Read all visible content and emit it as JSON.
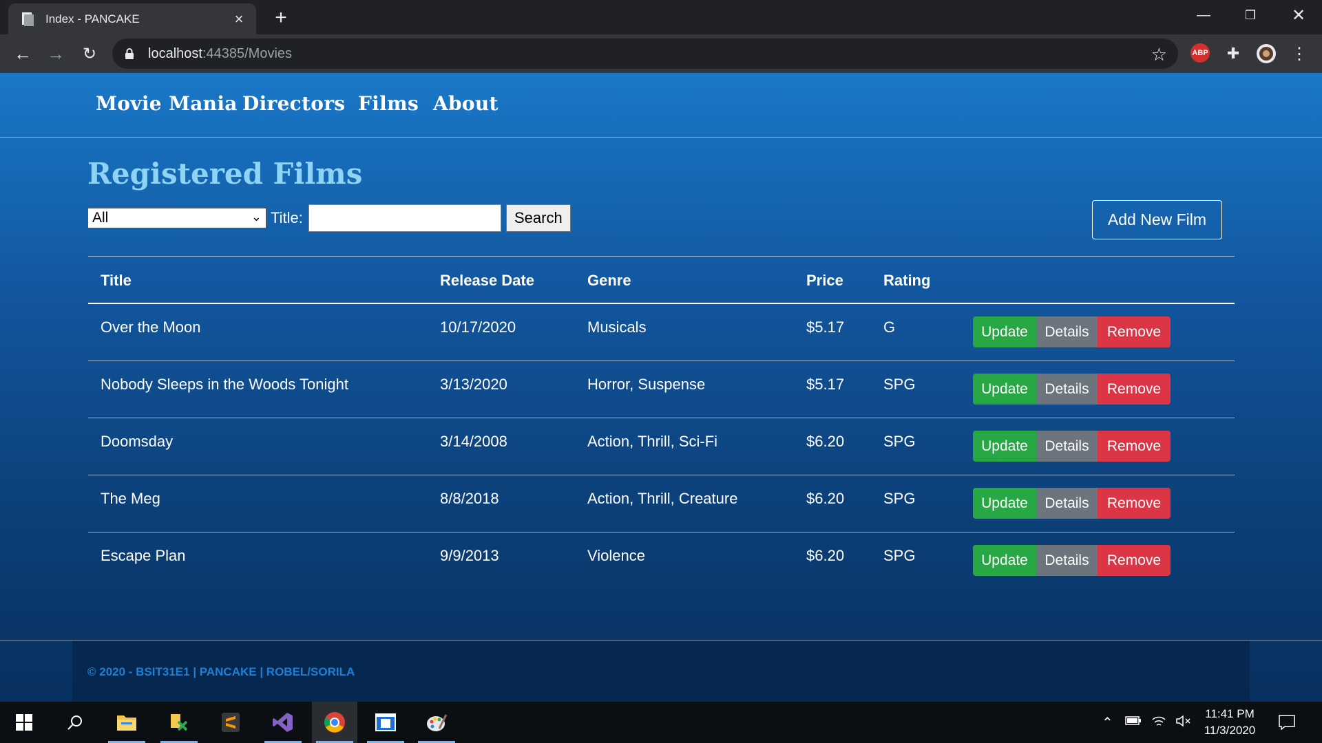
{
  "browser": {
    "tab_title": "Index - PANCAKE",
    "url_host": "localhost",
    "url_rest": ":44385/Movies",
    "abp_label": "ABP"
  },
  "nav": {
    "brand": "Movie Mania",
    "links": [
      "Directors",
      "Films",
      "About"
    ]
  },
  "page": {
    "heading": "Registered Films",
    "filter_selected": "All",
    "title_label": "Title:",
    "title_value": "",
    "search_label": "Search",
    "add_button": "Add New Film"
  },
  "table": {
    "columns": [
      "Title",
      "Release Date",
      "Genre",
      "Price",
      "Rating"
    ],
    "rows": [
      {
        "title": "Over the Moon",
        "release": "10/17/2020",
        "genre": "Musicals",
        "price": "$5.17",
        "rating": "G"
      },
      {
        "title": "Nobody Sleeps in the Woods Tonight",
        "release": "3/13/2020",
        "genre": "Horror, Suspense",
        "price": "$5.17",
        "rating": "SPG"
      },
      {
        "title": "Doomsday",
        "release": "3/14/2008",
        "genre": "Action, Thrill, Sci-Fi",
        "price": "$6.20",
        "rating": "SPG"
      },
      {
        "title": "The Meg",
        "release": "8/8/2018",
        "genre": "Action, Thrill, Creature",
        "price": "$6.20",
        "rating": "SPG"
      },
      {
        "title": "Escape Plan",
        "release": "9/9/2013",
        "genre": "Violence",
        "price": "$6.20",
        "rating": "SPG"
      }
    ],
    "actions": {
      "update": "Update",
      "details": "Details",
      "remove": "Remove"
    }
  },
  "footer": {
    "text": "© 2020 - BSIT31E1 | PANCAKE | ROBEL/SORILA"
  },
  "taskbar": {
    "time": "11:41 PM",
    "date": "11/3/2020"
  },
  "colors": {
    "accent": "#8fd4f5",
    "update": "#28a745",
    "details": "#6c757d",
    "remove": "#dc3545"
  }
}
